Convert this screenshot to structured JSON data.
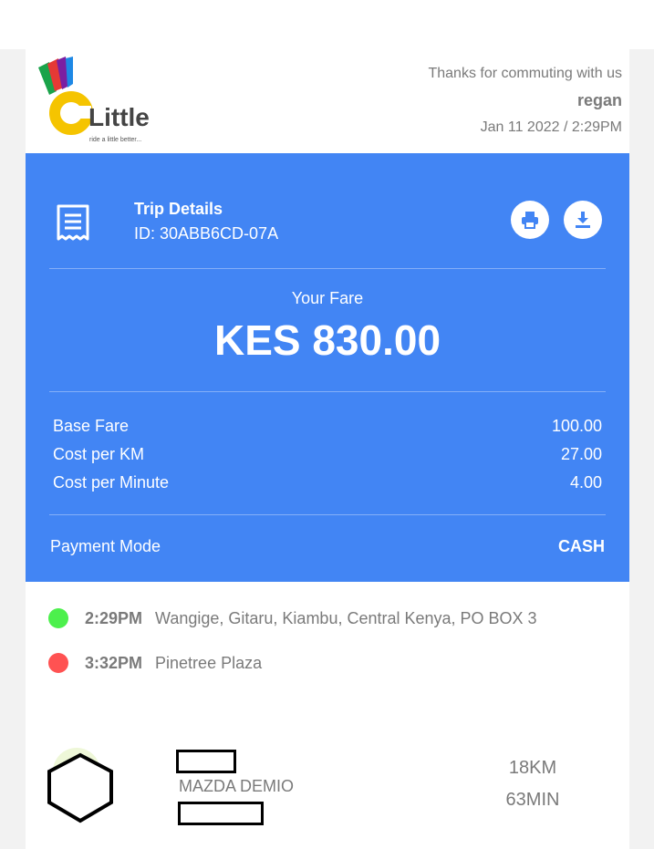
{
  "header": {
    "brand_name": "Little",
    "brand_tagline": "ride a little better...",
    "thanks_text": "Thanks for commuting with us",
    "user_name": "regan",
    "date_time": "Jan 11 2022 / 2:29PM"
  },
  "trip": {
    "title": "Trip Details",
    "id_text": "ID: 30ABB6CD-07A",
    "icons": {
      "receipt": "receipt-icon",
      "print": "print-icon",
      "download": "download-icon"
    }
  },
  "fare": {
    "label": "Your Fare",
    "amount": "KES 830.00"
  },
  "breakdown": [
    {
      "label": "Base Fare",
      "value": "100.00"
    },
    {
      "label": "Cost per KM",
      "value": "27.00"
    },
    {
      "label": "Cost per Minute",
      "value": "4.00"
    }
  ],
  "payment": {
    "label": "Payment Mode",
    "value": "CASH"
  },
  "stops": [
    {
      "time": "2:29PM",
      "place": "Wangige, Gitaru, Kiambu, Central Kenya, PO BOX 3",
      "color": "#4cf04c"
    },
    {
      "time": "3:32PM",
      "place": "Pinetree Plaza",
      "color": "#ff5252"
    }
  ],
  "vehicle": {
    "model": "MAZDA DEMIO",
    "distance": "18KM",
    "duration": "63MIN"
  },
  "colors": {
    "accent": "#4285f4",
    "text_muted": "#7a7a7a"
  }
}
